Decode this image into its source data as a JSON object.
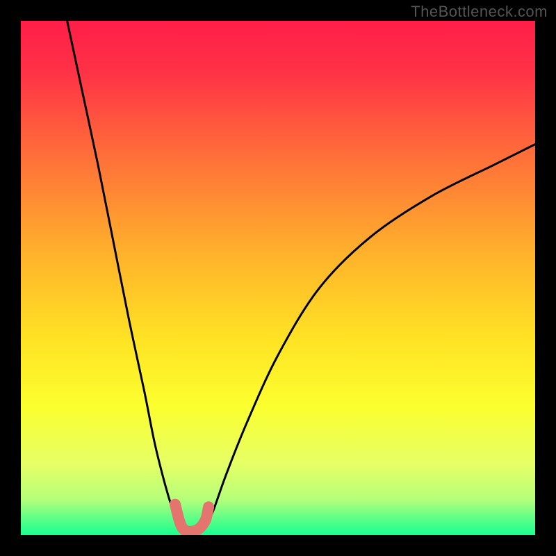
{
  "watermark": "TheBottleneck.com",
  "chart_data": {
    "type": "line",
    "title": "",
    "xlabel": "",
    "ylabel": "",
    "xlim": [
      0,
      100
    ],
    "ylim": [
      0,
      100
    ],
    "series": [
      {
        "name": "curve-left",
        "x": [
          9,
          12,
          15,
          18,
          21,
          24,
          26,
          28,
          29.5,
          30.5,
          31.5
        ],
        "values": [
          100,
          86,
          72,
          57,
          42,
          28,
          18,
          10,
          5,
          2.5,
          1.2
        ]
      },
      {
        "name": "curve-right",
        "x": [
          36,
          37.5,
          40,
          44,
          50,
          58,
          68,
          80,
          92,
          100
        ],
        "values": [
          1.5,
          5,
          12,
          22,
          35,
          48,
          58,
          66,
          72,
          76
        ]
      },
      {
        "name": "basin-highlight",
        "x": [
          30,
          30.7,
          31.3,
          32,
          32.8,
          33.6,
          34.4,
          35.2,
          36,
          36.5
        ],
        "values": [
          6,
          3.2,
          1.6,
          0.9,
          0.7,
          0.8,
          1.1,
          1.8,
          3.2,
          5.5
        ]
      }
    ],
    "gradient_stops": [
      {
        "offset": 0.0,
        "color": "#ff1e49"
      },
      {
        "offset": 0.1,
        "color": "#ff3246"
      },
      {
        "offset": 0.25,
        "color": "#ff6a3a"
      },
      {
        "offset": 0.45,
        "color": "#ffb12b"
      },
      {
        "offset": 0.62,
        "color": "#ffe324"
      },
      {
        "offset": 0.75,
        "color": "#fbff2f"
      },
      {
        "offset": 0.86,
        "color": "#e6ff65"
      },
      {
        "offset": 0.93,
        "color": "#b6ff7a"
      },
      {
        "offset": 0.965,
        "color": "#63ff87"
      },
      {
        "offset": 1.0,
        "color": "#18ff8f"
      }
    ],
    "basin_color": "#e4756e",
    "curve_color": "#000000"
  }
}
